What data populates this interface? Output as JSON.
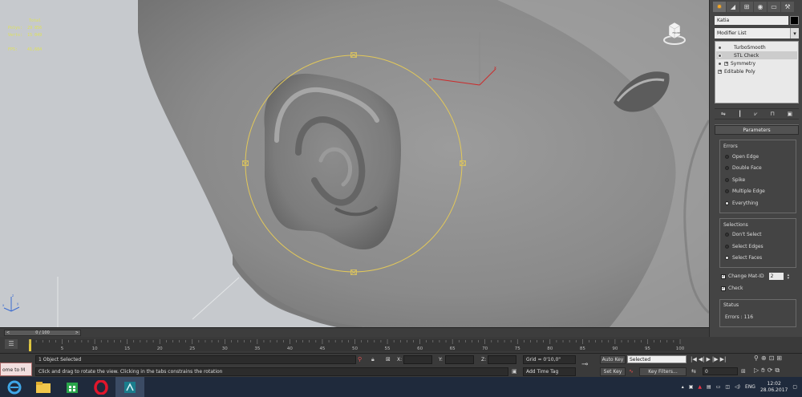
{
  "viewport": {
    "stats": {
      "header": "Total",
      "rows": [
        {
          "label": "Polys:",
          "value": "29 856"
        },
        {
          "label": "Verts:",
          "value": "15 049"
        },
        {
          "label": "FPS:",
          "value": "41,684"
        }
      ]
    },
    "viewcube_label": "FRONT"
  },
  "command_panel": {
    "object_name": "Katia",
    "modifier_list": "Modifier List",
    "stack": [
      "TurboSmooth",
      "STL Check",
      "Symmetry",
      "Editable Poly"
    ],
    "rollout_title": "Parameters",
    "errors_group": {
      "title": "Errors",
      "options": [
        "Open Edge",
        "Double Face",
        "Spike",
        "Multiple Edge",
        "Everything"
      ],
      "selected": "Everything"
    },
    "selections_group": {
      "title": "Selections",
      "options": [
        "Don't Select",
        "Select Edges",
        "Select Faces"
      ],
      "selected": "Select Faces"
    },
    "change_mat_id_label": "Change Mat-ID",
    "change_mat_id_value": "2",
    "check_label": "Check",
    "status_group": {
      "title": "Status",
      "value": "Errors : 116"
    }
  },
  "timeline": {
    "slider_label": "0 / 100",
    "ruler_ticks": [
      "0",
      "5",
      "10",
      "15",
      "20",
      "25",
      "30",
      "35",
      "40",
      "45",
      "50",
      "55",
      "60",
      "65",
      "70",
      "75",
      "80",
      "85",
      "90",
      "95",
      "100"
    ]
  },
  "status_bar": {
    "maxscript": "ome to M",
    "selection_info": "1 Object Selected",
    "prompt": "Click and drag to rotate the view.  Clicking in the tabs constrains the rotation",
    "x_label": "X:",
    "y_label": "Y:",
    "z_label": "Z:",
    "grid": "Grid = 0'10,0\"",
    "add_time_tag": "Add Time Tag",
    "auto_key": "Auto Key",
    "set_key": "Set Key",
    "key_mode_selected": "Selected",
    "key_filters": "Key Filters...",
    "current_frame": "0"
  },
  "taskbar": {
    "language": "ENG",
    "time": "12:02",
    "date": "28.06.2017"
  },
  "colors": {
    "selection_circle": "#e2c85a",
    "stats_text": "#dfe257",
    "viewport_bg": "#c6c9cd"
  }
}
